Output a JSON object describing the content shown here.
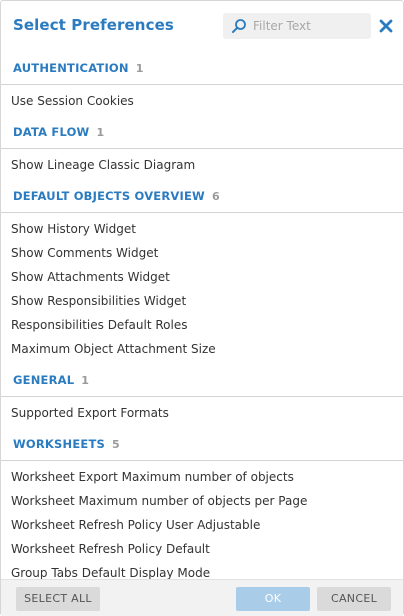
{
  "dialog": {
    "title": "Select Preferences",
    "filter_placeholder": "Filter Text",
    "filter_value": ""
  },
  "sections": [
    {
      "name": "AUTHENTICATION",
      "count": "1",
      "items": [
        "Use Session Cookies"
      ]
    },
    {
      "name": "DATA FLOW",
      "count": "1",
      "items": [
        "Show Lineage Classic Diagram"
      ]
    },
    {
      "name": "DEFAULT OBJECTS OVERVIEW",
      "count": "6",
      "items": [
        "Show History Widget",
        "Show Comments Widget",
        "Show Attachments Widget",
        "Show Responsibilities Widget",
        "Responsibilities Default Roles",
        "Maximum Object Attachment Size"
      ]
    },
    {
      "name": "GENERAL",
      "count": "1",
      "items": [
        "Supported Export Formats"
      ]
    },
    {
      "name": "WORKSHEETS",
      "count": "5",
      "items": [
        "Worksheet Export Maximum number of objects",
        "Worksheet Maximum number of objects per Page",
        "Worksheet Refresh Policy User Adjustable",
        "Worksheet Refresh Policy Default",
        "Group Tabs Default Display Mode"
      ]
    }
  ],
  "footer": {
    "select_all_label": "SELECT ALL",
    "ok_label": "OK",
    "cancel_label": "CANCEL"
  },
  "colors": {
    "accent": "#2b7bc0",
    "ok_disabled": "#a9cde9",
    "button_gray": "#dadada"
  },
  "icons": {
    "search": "search-icon",
    "close": "close-icon"
  }
}
